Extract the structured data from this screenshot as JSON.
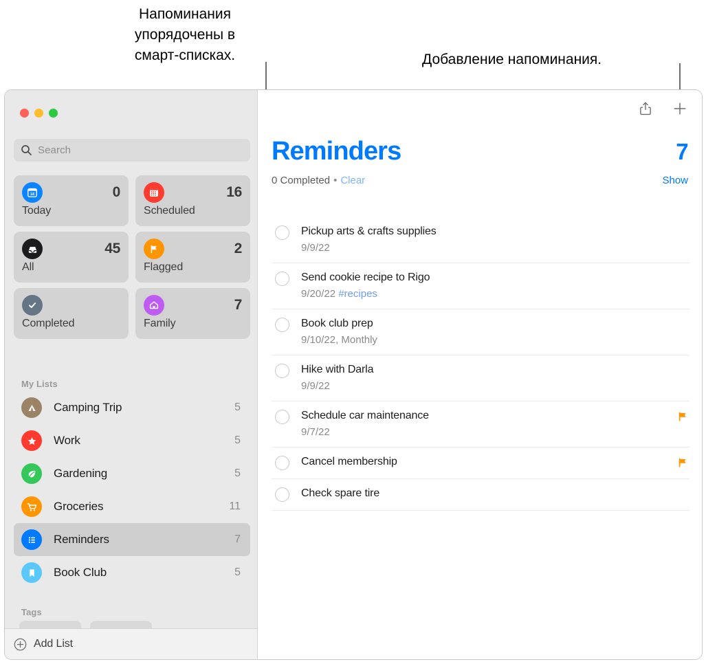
{
  "callouts": {
    "left": "Напоминания\nупорядочены в\nсмарт-списках.",
    "right": "Добавление напоминания."
  },
  "window": {
    "traffic_lights": {
      "close": "close-button",
      "minimize": "minimize-button",
      "zoom": "zoom-button"
    }
  },
  "sidebar": {
    "search": {
      "placeholder": "Search",
      "value": "",
      "icon": "search-icon"
    },
    "smart_lists": [
      {
        "label": "Today",
        "count": "0",
        "icon": "calendar-icon",
        "color": "#0a84ff"
      },
      {
        "label": "Scheduled",
        "count": "16",
        "icon": "calendar-grid-icon",
        "color": "#ff3b30"
      },
      {
        "label": "All",
        "count": "45",
        "icon": "inbox-tray-icon",
        "color": "#1c1c1e"
      },
      {
        "label": "Flagged",
        "count": "2",
        "icon": "flag-icon",
        "color": "#ff9500"
      },
      {
        "label": "Completed",
        "count": "",
        "icon": "checkmark-icon",
        "color": "#647585"
      },
      {
        "label": "Family",
        "count": "7",
        "icon": "house-icon",
        "color": "#bf5af2"
      }
    ],
    "my_lists_header": "My Lists",
    "my_lists": [
      {
        "label": "Camping Trip",
        "count": "5",
        "icon": "tent-icon",
        "color": "#9b8466",
        "selected": false
      },
      {
        "label": "Work",
        "count": "5",
        "icon": "star-icon",
        "color": "#ff3b30",
        "selected": false
      },
      {
        "label": "Gardening",
        "count": "5",
        "icon": "leaf-icon",
        "color": "#34c759",
        "selected": false
      },
      {
        "label": "Groceries",
        "count": "11",
        "icon": "cart-icon",
        "color": "#ff9500",
        "selected": false
      },
      {
        "label": "Reminders",
        "count": "7",
        "icon": "list-icon",
        "color": "#007aff",
        "selected": true
      },
      {
        "label": "Book Club",
        "count": "5",
        "icon": "bookmark-icon",
        "color": "#5ac8fa",
        "selected": false
      }
    ],
    "tags_header": "Tags",
    "tags": [
      {
        "label": ""
      },
      {
        "label": ""
      }
    ],
    "add_list_label": "Add List"
  },
  "toolbar": {
    "share_icon": "share-icon",
    "add_icon": "plus-icon"
  },
  "main": {
    "title": "Reminders",
    "total": "7",
    "completed_text": "0 Completed",
    "separator": "•",
    "clear_label": "Clear",
    "show_label": "Show",
    "reminders": [
      {
        "title": "Pickup arts & crafts supplies",
        "date": "9/9/22",
        "extra": "",
        "tag": "",
        "flagged": false
      },
      {
        "title": "Send cookie recipe to Rigo",
        "date": "9/20/22",
        "extra": "",
        "tag": "#recipes",
        "flagged": false
      },
      {
        "title": "Book club prep",
        "date": "9/10/22,",
        "extra": "Monthly",
        "tag": "",
        "flagged": false
      },
      {
        "title": "Hike with Darla",
        "date": "9/9/22",
        "extra": "",
        "tag": "",
        "flagged": false
      },
      {
        "title": "Schedule car maintenance",
        "date": "9/7/22",
        "extra": "",
        "tag": "",
        "flagged": true
      },
      {
        "title": "Cancel membership",
        "date": "",
        "extra": "",
        "tag": "",
        "flagged": true
      },
      {
        "title": "Check spare tire",
        "date": "",
        "extra": "",
        "tag": "",
        "flagged": false
      }
    ]
  },
  "colors": {
    "accent": "#007aff",
    "flag": "#ff9500",
    "sidebar_bg": "#e9e9e9",
    "card_bg": "#d3d3d3"
  }
}
